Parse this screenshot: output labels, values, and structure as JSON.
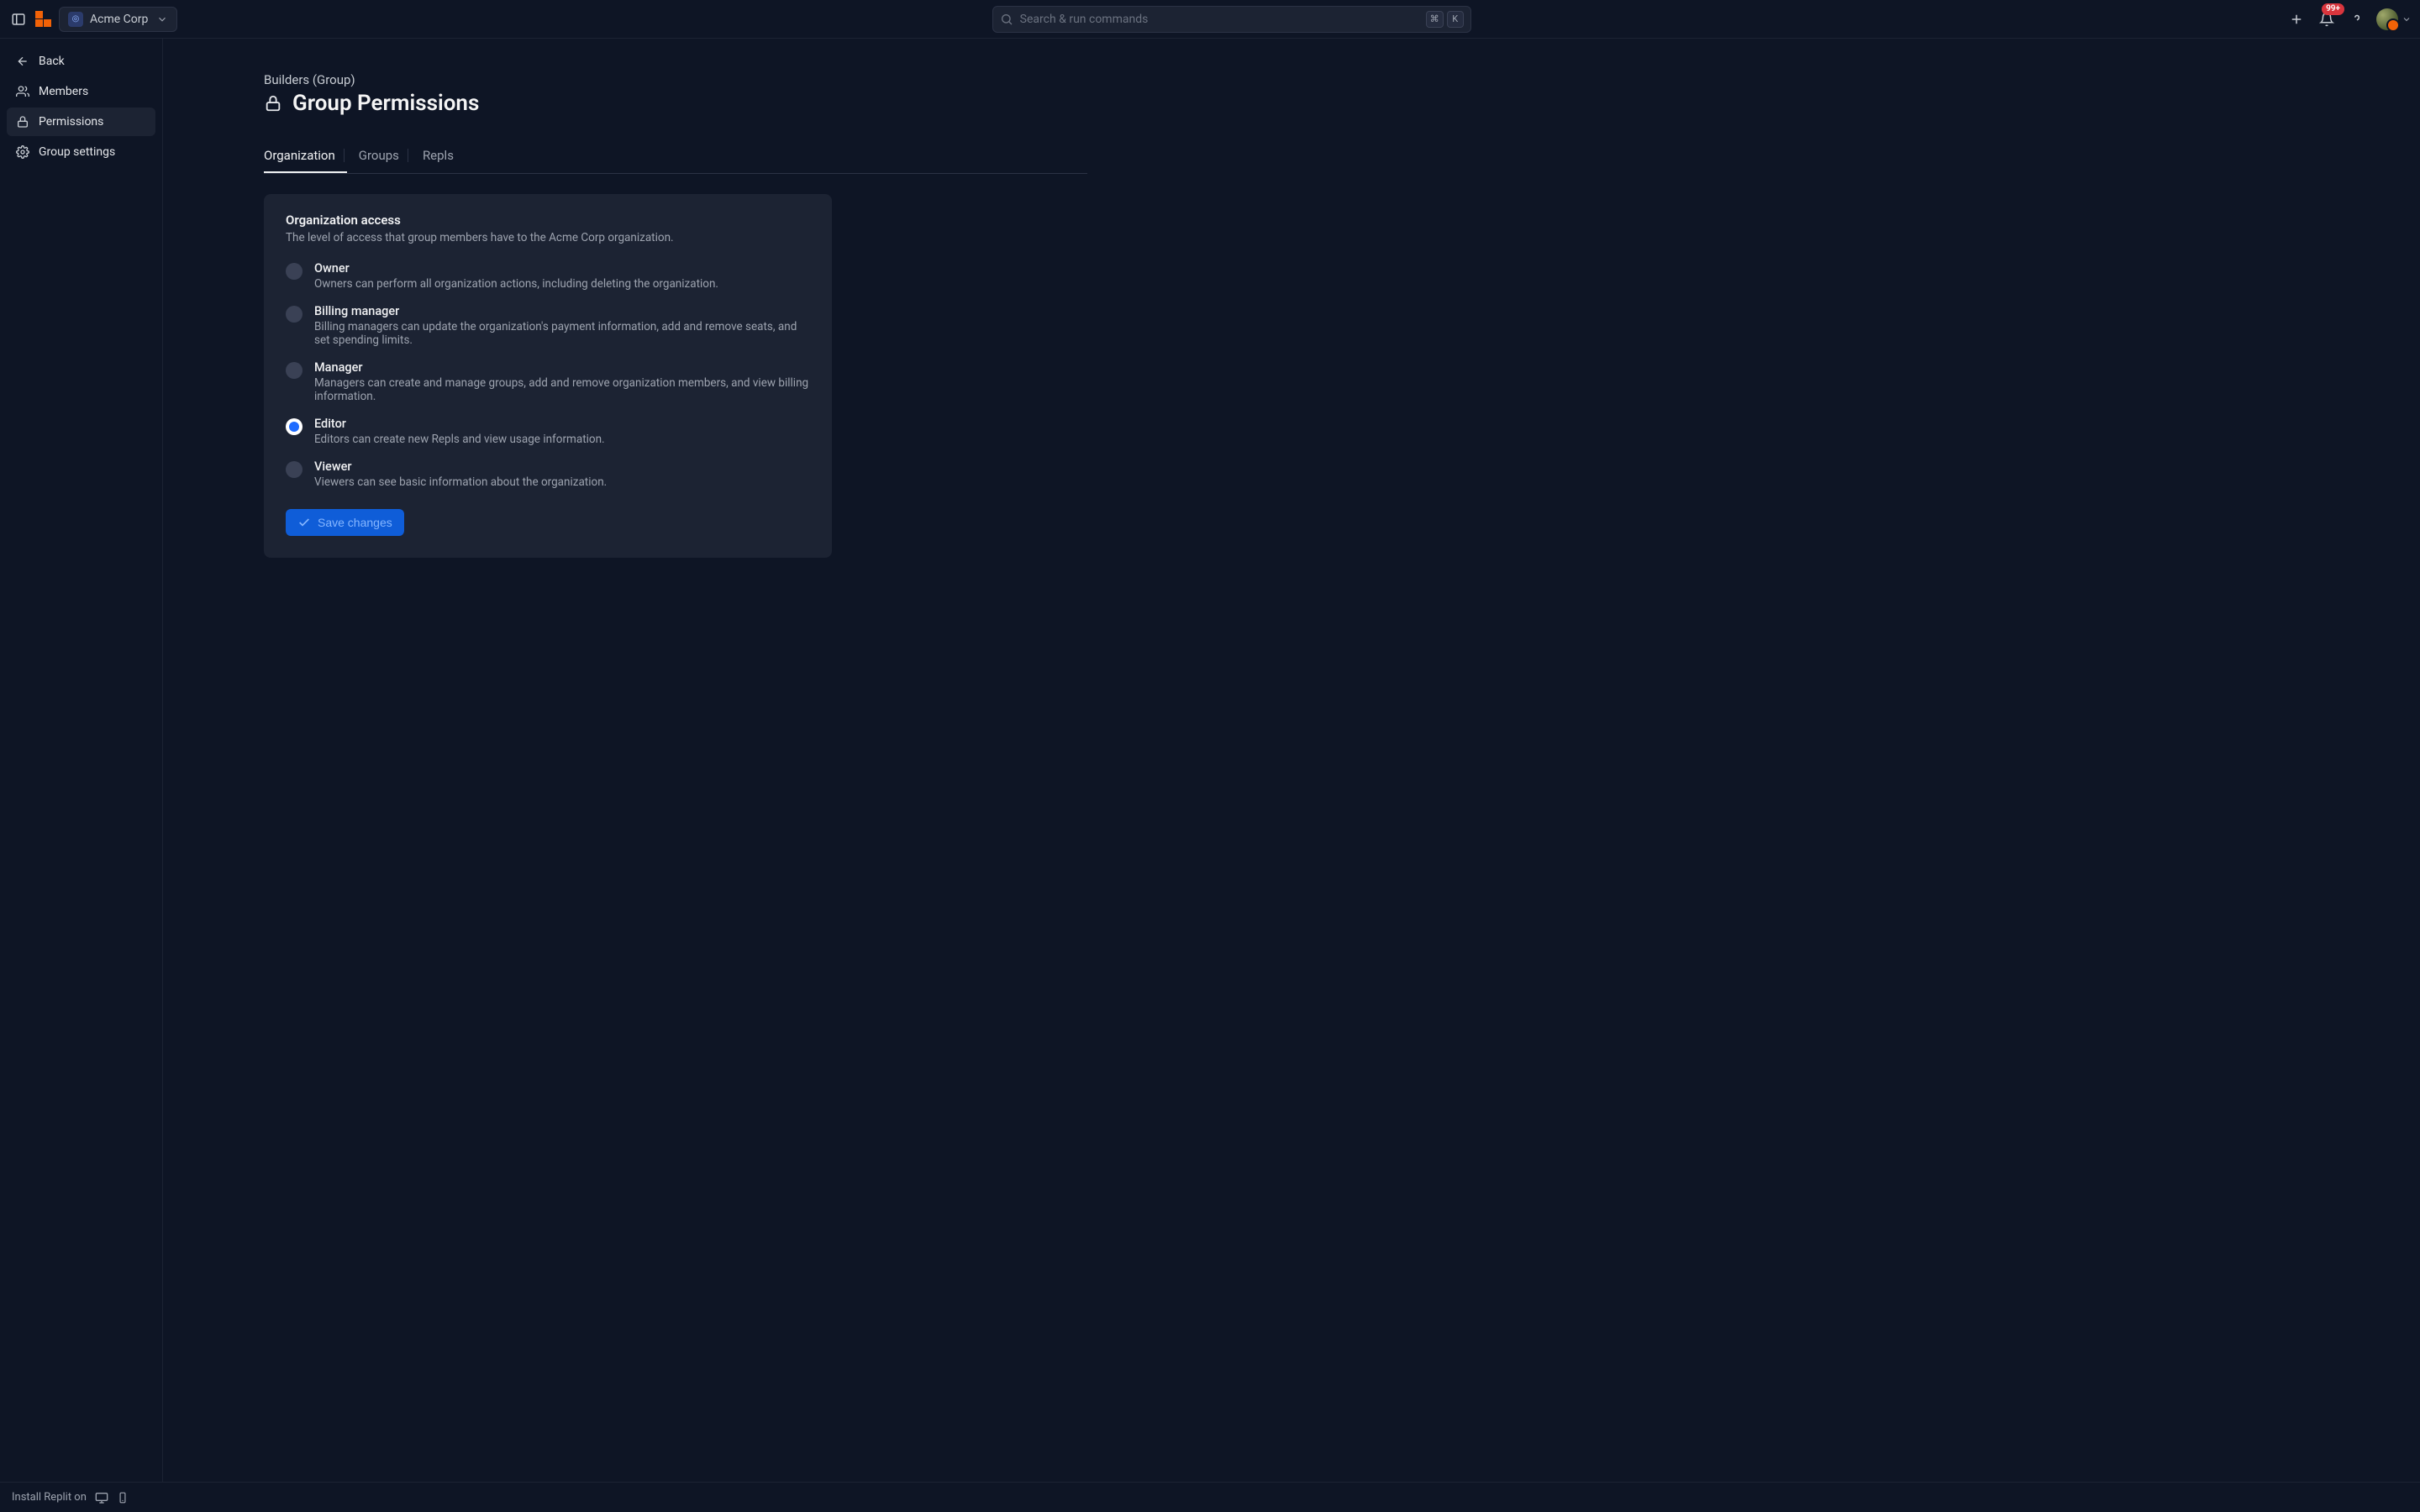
{
  "header": {
    "org_name": "Acme Corp",
    "search_placeholder": "Search & run commands",
    "shortcut_keys": [
      "⌘",
      "K"
    ],
    "notification_badge": "99+"
  },
  "sidebar": {
    "items": [
      {
        "icon": "arrow-left",
        "label": "Back"
      },
      {
        "icon": "users",
        "label": "Members"
      },
      {
        "icon": "lock",
        "label": "Permissions",
        "active": true
      },
      {
        "icon": "gear",
        "label": "Group settings"
      }
    ]
  },
  "page": {
    "breadcrumb": "Builders (Group)",
    "title": "Group Permissions"
  },
  "tabs": [
    {
      "label": "Organization",
      "active": true
    },
    {
      "label": "Groups"
    },
    {
      "label": "Repls"
    }
  ],
  "org_access": {
    "heading": "Organization access",
    "description": "The level of access that group members have to the Acme Corp organization.",
    "options": [
      {
        "title": "Owner",
        "desc": "Owners can perform all organization actions, including deleting the organization."
      },
      {
        "title": "Billing manager",
        "desc": "Billing managers can update the organization's payment information, add and remove seats, and set spending limits."
      },
      {
        "title": "Manager",
        "desc": "Managers can create and manage groups, add and remove organization members, and view billing information."
      },
      {
        "title": "Editor",
        "desc": "Editors can create new Repls and view usage information.",
        "selected": true
      },
      {
        "title": "Viewer",
        "desc": "Viewers can see basic information about the organization."
      }
    ],
    "save_label": "Save changes"
  },
  "footer": {
    "install_label": "Install Replit on"
  }
}
